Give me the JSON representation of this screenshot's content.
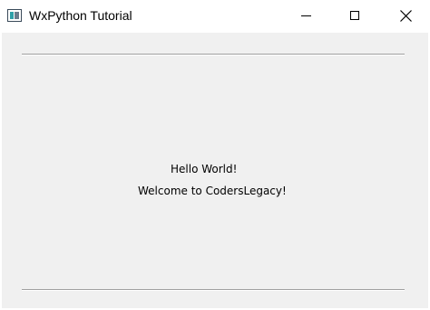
{
  "window": {
    "title": "WxPython Tutorial",
    "icon": "wxpython-app-icon"
  },
  "titlebar": {
    "buttons": [
      {
        "name": "minimize",
        "icon": "minimize-icon"
      },
      {
        "name": "maximize",
        "icon": "maximize-icon"
      },
      {
        "name": "close",
        "icon": "close-icon"
      }
    ]
  },
  "content": {
    "line1": "Hello World!",
    "line2": "Welcome to CodersLegacy!"
  }
}
